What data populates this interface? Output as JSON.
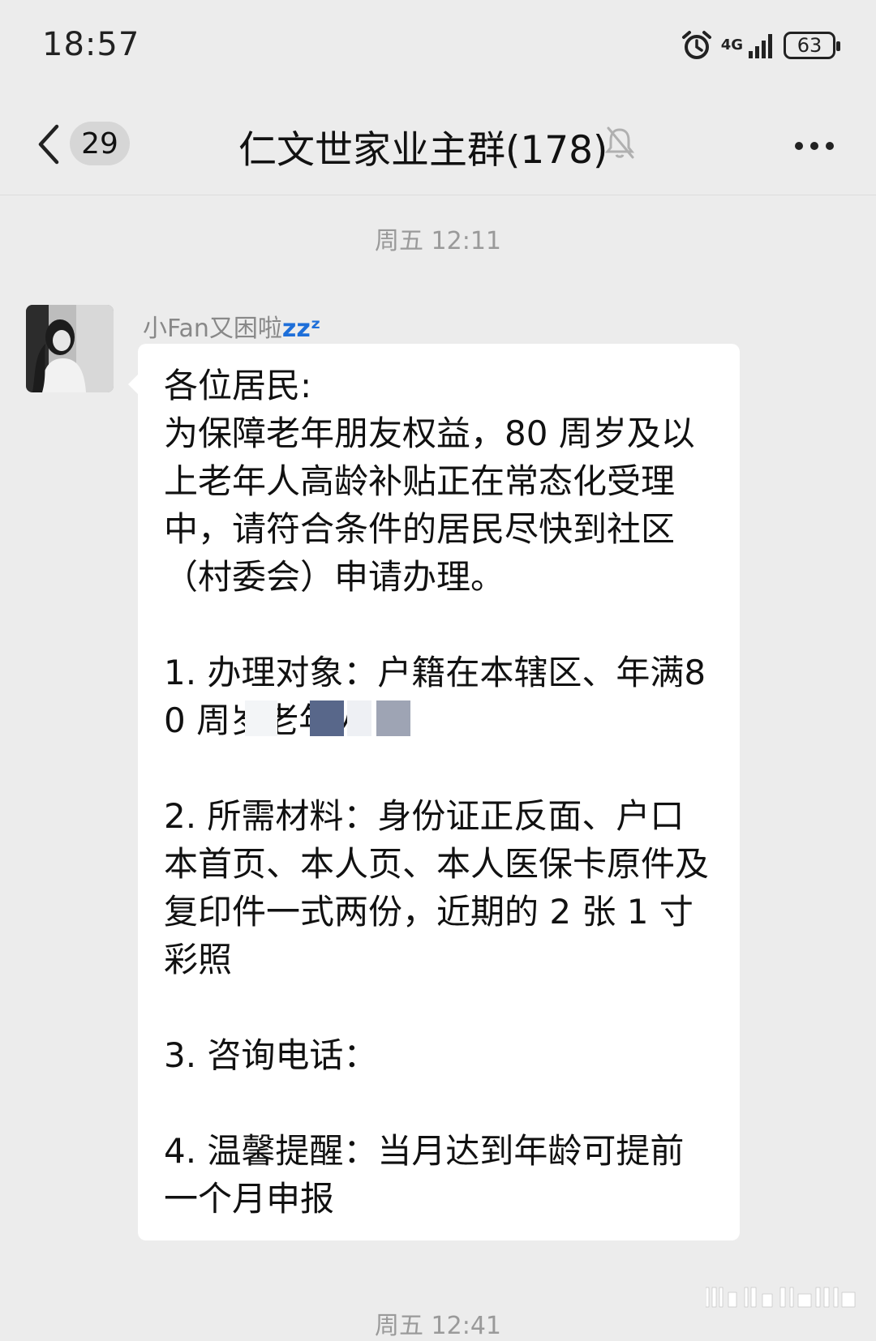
{
  "status_bar": {
    "time": "18:57",
    "network": "4G",
    "battery": "63"
  },
  "header": {
    "unread_count": "29",
    "title": "仁文世家业主群(178)"
  },
  "messages": {
    "timestamp_1": "周五 12:11",
    "sender_name": "小Fan又困啦",
    "sender_suffix": "zzᶻ",
    "body": "各位居民:\n为保障老年朋友权益，80 周岁及以上老年人高龄补贴正在常态化受理中，请符合条件的居民尽快到社区（村委会）申请办理。\n\n1. 办理对象：户籍在本辖区、年满80 周岁老年人\n\n2. 所需材料：身份证正反面、户口本首页、本人页、本人医保卡原件及复印件一式两份，近期的 2 张 1 寸彩照\n\n3. 咨询电话：\n\n4. 温馨提醒：当月达到年龄可提前一个月申报",
    "timestamp_2": "周五 12:41"
  },
  "colors": {
    "background": "#ececec",
    "bubble": "#ffffff",
    "timestamp": "#9a9a9a",
    "sender": "#888888",
    "zzz": "#1e6fd9"
  },
  "icons": [
    "back-arrow-icon",
    "bell-muted-icon",
    "more-icon",
    "alarm-icon",
    "signal-icon",
    "battery-icon"
  ]
}
